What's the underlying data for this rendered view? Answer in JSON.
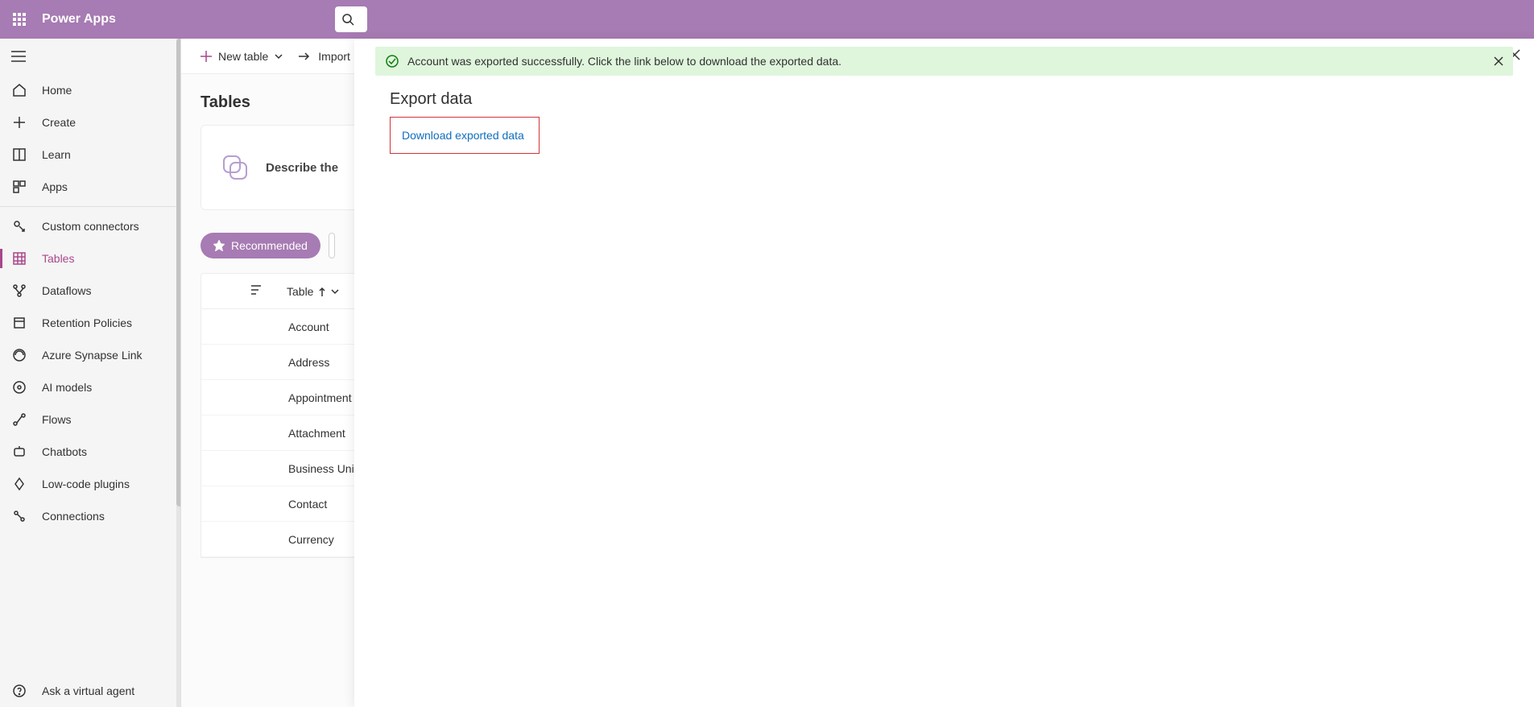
{
  "header": {
    "app_name": "Power Apps"
  },
  "nav": {
    "home": "Home",
    "create": "Create",
    "learn": "Learn",
    "apps": "Apps",
    "custom_connectors": "Custom connectors",
    "tables": "Tables",
    "dataflows": "Dataflows",
    "retention": "Retention Policies",
    "synapse": "Azure Synapse Link",
    "ai_models": "AI models",
    "flows": "Flows",
    "chatbots": "Chatbots",
    "low_code": "Low-code plugins",
    "connections": "Connections",
    "ask_agent": "Ask a virtual agent"
  },
  "toolbar": {
    "new_table": "New table",
    "import": "Import"
  },
  "main": {
    "title": "Tables",
    "describe_label": "Describe the",
    "recommended": "Recommended",
    "column_header": "Table",
    "rows": {
      "r0": "Account",
      "r1": "Address",
      "r2": "Appointment",
      "r3": "Attachment",
      "r4": "Business Unit",
      "r5": "Contact",
      "r6": "Currency"
    }
  },
  "panel": {
    "alert": "Account was exported successfully. Click the link below to download the exported data.",
    "title": "Export data",
    "download": "Download exported data"
  }
}
